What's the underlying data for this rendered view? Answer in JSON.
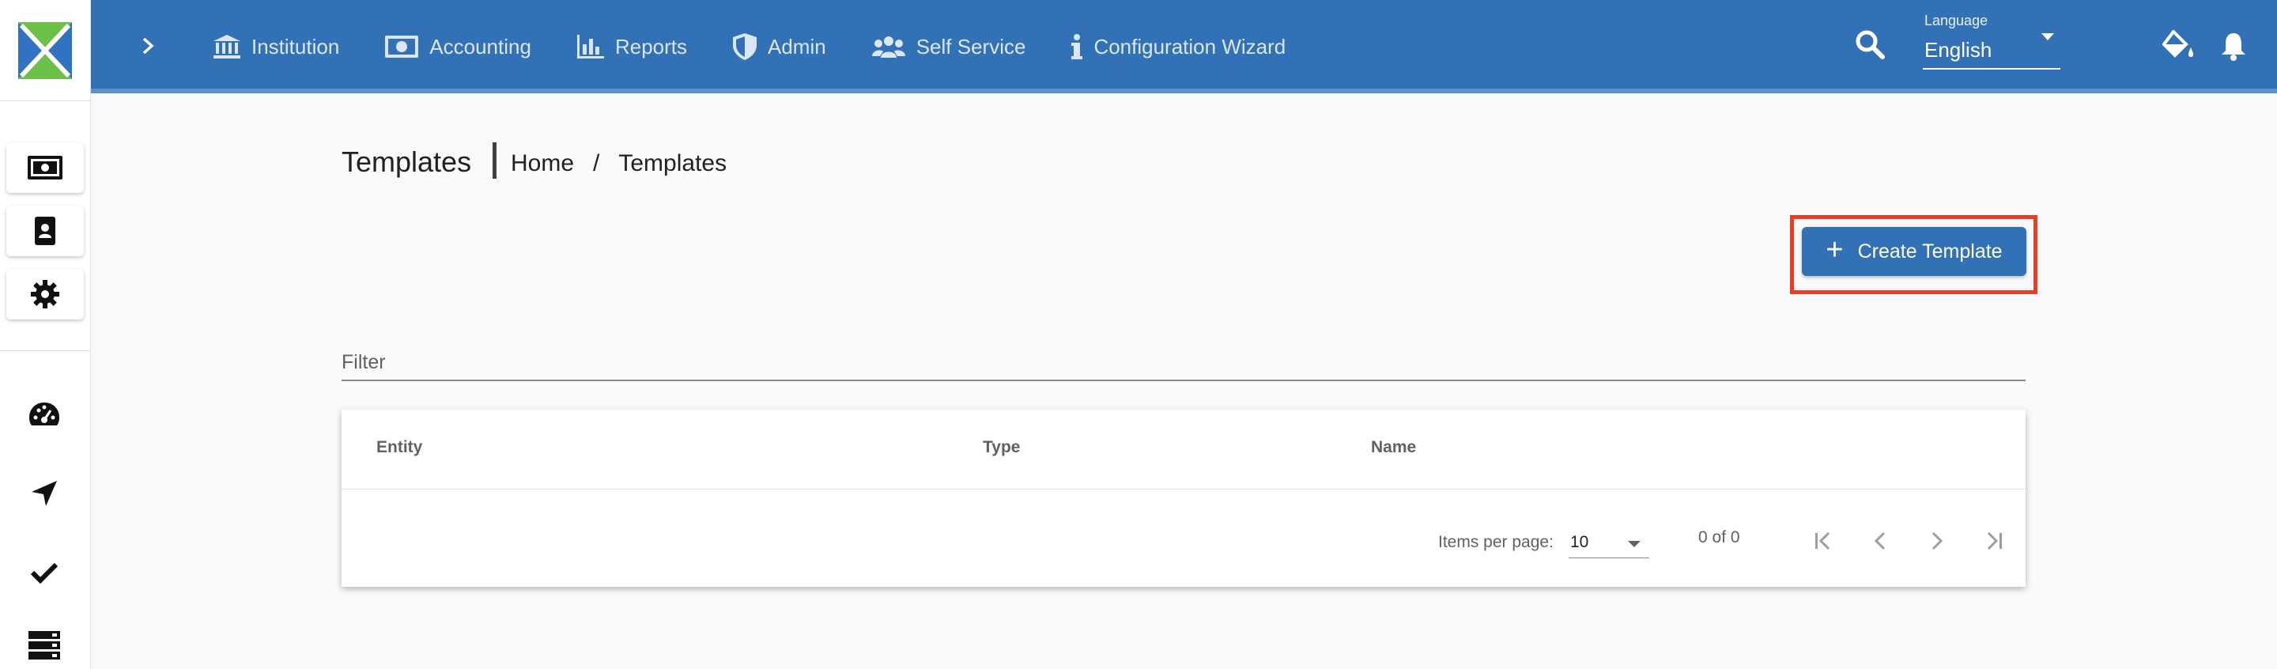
{
  "header": {
    "nav": [
      {
        "label": "Institution",
        "icon": "institution-icon"
      },
      {
        "label": "Accounting",
        "icon": "money-icon"
      },
      {
        "label": "Reports",
        "icon": "bar-chart-icon"
      },
      {
        "label": "Admin",
        "icon": "shield-icon"
      },
      {
        "label": "Self Service",
        "icon": "users-icon"
      },
      {
        "label": "Configuration Wizard",
        "icon": "info-icon"
      }
    ],
    "language": {
      "caption": "Language",
      "value": "English"
    }
  },
  "sidebar": {
    "cards": [
      "money-icon",
      "contact-card-icon",
      "gear-icon"
    ],
    "icons": [
      "dashboard-icon",
      "navigation-arrow-icon",
      "check-icon",
      "server-icon"
    ]
  },
  "page": {
    "title": "Templates",
    "breadcrumb": [
      "Home",
      "/",
      "Templates"
    ],
    "create_button": "Create Template",
    "filter_placeholder": "Filter"
  },
  "table": {
    "columns": [
      "Entity",
      "Type",
      "Name"
    ],
    "rows": [],
    "paginator": {
      "items_per_page_label": "Items per page:",
      "items_per_page": "10",
      "range": "0 of 0"
    }
  },
  "colors": {
    "primary": "#3271b5",
    "highlight": "#e53f27",
    "logo_green": "#4caf50",
    "logo_blue": "#2f73c1"
  }
}
